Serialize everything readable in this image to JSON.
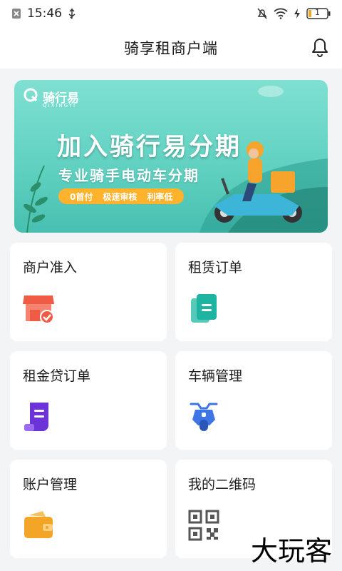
{
  "status": {
    "time": "15:46",
    "battery": "1"
  },
  "header": {
    "title": "骑享租商户端"
  },
  "banner": {
    "brand": "骑行易",
    "brand_sub": "QIXINGYI",
    "title": "加入骑行易分期",
    "subtitle": "专业骑手电动车分期",
    "tags": [
      "0首付",
      "极速审核",
      "利率低"
    ]
  },
  "menu": [
    {
      "label": "商户准入",
      "icon": "storefront-icon",
      "color": "#ef5b45"
    },
    {
      "label": "租赁订单",
      "icon": "document-icon",
      "color": "#1fb3a2"
    },
    {
      "label": "租金贷订单",
      "icon": "receipt-icon",
      "color": "#6b33d8"
    },
    {
      "label": "车辆管理",
      "icon": "scooter-icon",
      "color": "#3d74e6"
    },
    {
      "label": "账户管理",
      "icon": "wallet-icon",
      "color": "#f2a526"
    },
    {
      "label": "我的二维码",
      "icon": "qr-code-icon",
      "color": "#555555"
    }
  ],
  "watermark": "大玩客"
}
